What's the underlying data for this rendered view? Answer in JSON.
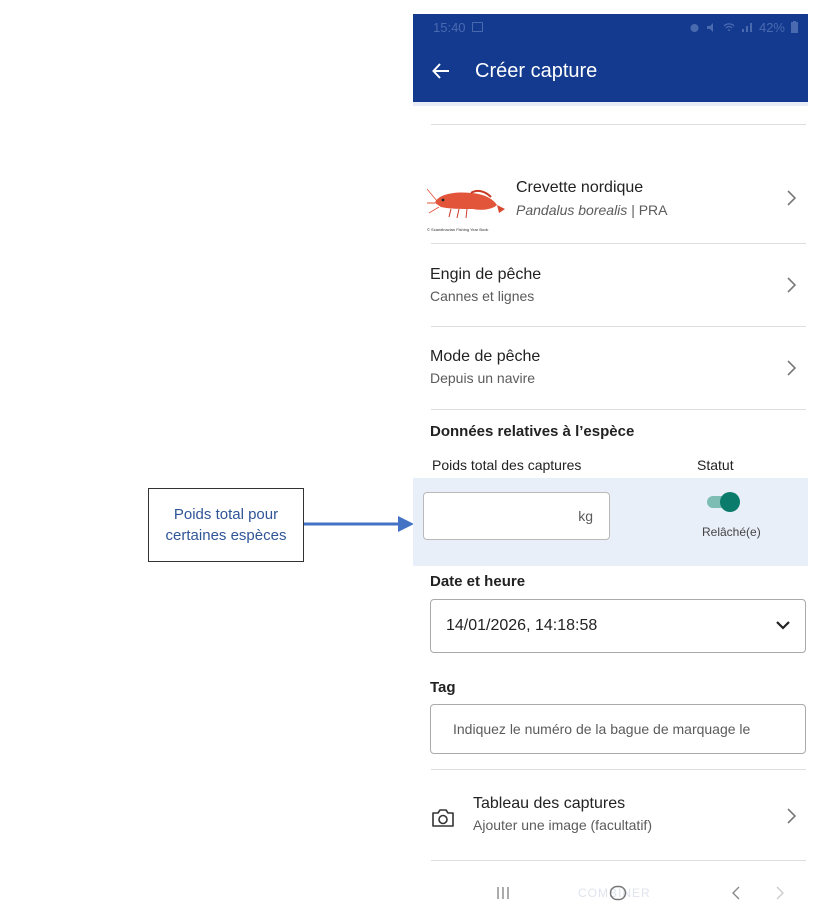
{
  "callout": {
    "text": "Poids total pour certaines espèces"
  },
  "status_bar": {
    "time": "15:40",
    "battery": "42%"
  },
  "app_bar": {
    "title": "Créer capture",
    "back_icon": "arrow-left-icon"
  },
  "species": {
    "common_name": "Crevette nordique",
    "scientific_name": "Pandalus borealis",
    "code": "| PRA",
    "image_caption": "© Scandinavian Fishing Year Book"
  },
  "gear": {
    "title": "Engin de pêche",
    "value": "Cannes et lignes"
  },
  "mode": {
    "title": "Mode de pêche",
    "value": "Depuis un navire"
  },
  "species_data": {
    "heading": "Données relatives à l’espèce",
    "weight_label": "Poids total des captures",
    "status_label": "Statut",
    "weight_value": "",
    "weight_unit": "kg",
    "status_value": "Relâché(e)",
    "status_on": true,
    "toggle_color": "#0b7c6c"
  },
  "datetime": {
    "label": "Date et heure",
    "value": "14/01/2026, 14:18:58"
  },
  "tag": {
    "label": "Tag",
    "placeholder": "Indiquez le numéro de la bague de marquage le"
  },
  "catch_board": {
    "title": "Tableau des captures",
    "subtitle": "Ajouter une image (facultatif)",
    "icon": "camera-icon"
  },
  "bottom_ghost_text": "COMBINER",
  "colors": {
    "app_bar": "#133a8e",
    "accent": "#0b7c6c",
    "band": "#e9eff8",
    "callout_text": "#2f5597",
    "arrow": "#4472c4"
  }
}
